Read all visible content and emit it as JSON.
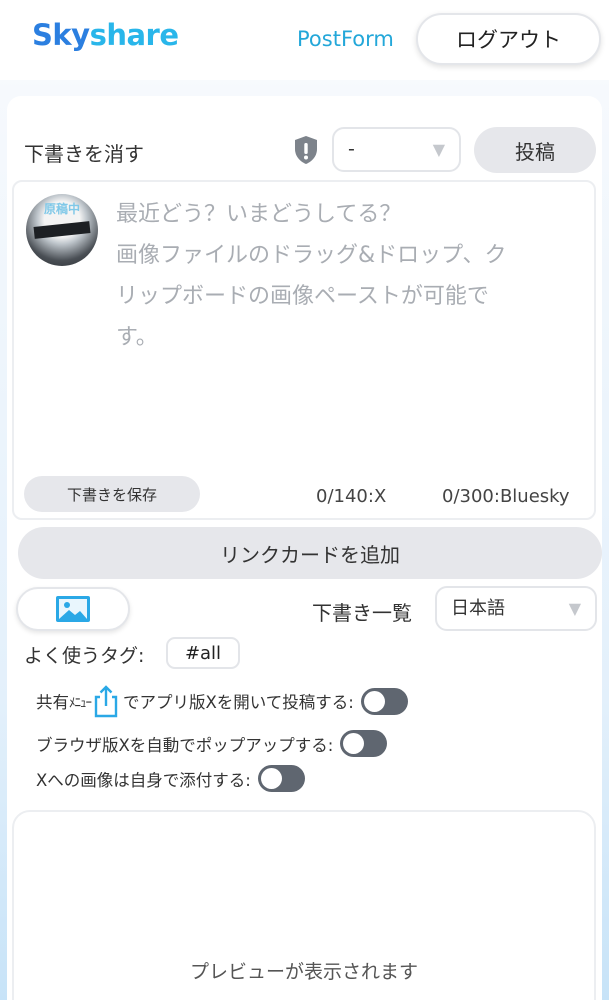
{
  "header": {
    "logo_sky": "Sky",
    "logo_share": "share",
    "postform_link": "PostForm",
    "logout_label": "ログアウト"
  },
  "toolbar": {
    "clear_draft_label": "下書きを消す",
    "warning_icon": "shield-exclamation-icon",
    "select_value": "-",
    "post_label": "投稿"
  },
  "compose": {
    "avatar_watermark": "原稿中",
    "placeholder": "最近どう？いまどうしてる？\n画像ファイルのドラッグ&ドロップ、クリップボードの画像ペーストが可能です。",
    "save_draft_label": "下書きを保存",
    "count_x": "0/140:X",
    "count_bluesky": "0/300:Bluesky"
  },
  "actions": {
    "linkcard_label": "リンクカードを追加",
    "image_icon": "image-icon",
    "drafts_list_label": "下書き一覧",
    "language_value": "日本語"
  },
  "tags": {
    "label": "よく使うタグ:",
    "items": [
      "#all"
    ]
  },
  "options": [
    {
      "prefix": "共有",
      "small": "ﾒﾆｭｰ",
      "icon": "share-icon",
      "suffix": "でアプリ版Xを開いて投稿する:",
      "on": false
    },
    {
      "prefix": "ブラウザ版Xを自動でポップアップする:",
      "on": false
    },
    {
      "prefix": "Xへの画像は自身で添付する:",
      "on": false
    }
  ],
  "preview": {
    "placeholder": "プレビューが表示されます"
  },
  "colors": {
    "brand_blue": "#2b7fe0",
    "brand_cyan": "#29b6ea",
    "toggle_off": "#5f6670",
    "button_gray": "#e6e7eb"
  }
}
